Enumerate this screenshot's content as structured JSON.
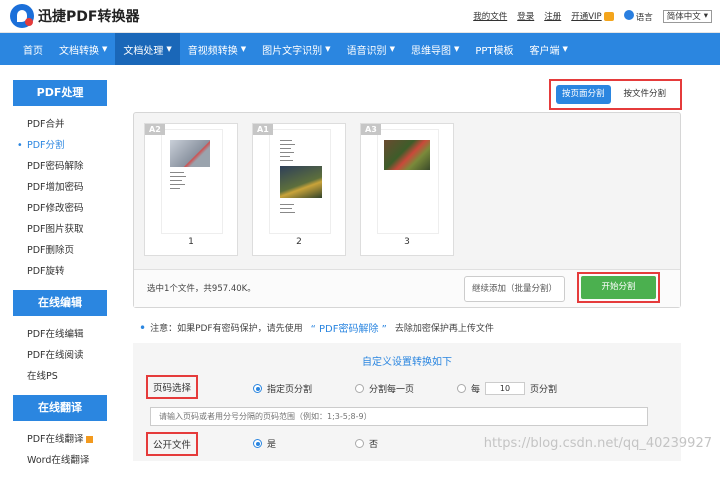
{
  "app": {
    "logo_text": "迅捷PDF转换器"
  },
  "top_links": {
    "my_files": "我的文件",
    "login": "登录",
    "register": "注册",
    "open_vip": "开通VIP",
    "language_label": "语言",
    "language_value": "简体中文"
  },
  "nav": {
    "items": [
      {
        "label": "首页"
      },
      {
        "label": "文档转换"
      },
      {
        "label": "文档处理"
      },
      {
        "label": "音视频转换"
      },
      {
        "label": "图片文字识别"
      },
      {
        "label": "语音识别"
      },
      {
        "label": "思维导图"
      },
      {
        "label": "PPT模板"
      },
      {
        "label": "客户端"
      }
    ]
  },
  "sidebar": {
    "pdf_head": "PDF处理",
    "pdf_items": [
      "PDF合并",
      "PDF分割",
      "PDF密码解除",
      "PDF增加密码",
      "PDF修改密码",
      "PDF图片获取",
      "PDF删除页",
      "PDF旋转"
    ],
    "edit_head": "在线编辑",
    "edit_items": [
      "PDF在线编辑",
      "PDF在线阅读",
      "在线PS"
    ],
    "translate_head": "在线翻译",
    "translate_items": [
      "PDF在线翻译",
      "Word在线翻译"
    ]
  },
  "split_tabs": {
    "by_page": "按页面分割",
    "by_file": "按文件分割"
  },
  "pages": [
    {
      "tag": "A2",
      "num": "1"
    },
    {
      "tag": "A1",
      "num": "2"
    },
    {
      "tag": "A3",
      "num": "3"
    }
  ],
  "preview_footer": {
    "file_info": "选中1个文件，共957.40K。",
    "continue_button": "继续添加（批量分割）",
    "start_button": "开始分割"
  },
  "notice": {
    "prefix": "注意：如果PDF有密码保护，请先使用",
    "link": "“ PDF密码解除 ”",
    "suffix": "去除加密保护再上传文件"
  },
  "settings": {
    "title": "自定义设置转换如下",
    "page_select_label": "页码选择",
    "opt_specified": "指定页分割",
    "opt_each_page": "分割每一页",
    "opt_every": "每",
    "every_value": "10",
    "opt_every_unit": "页分割",
    "range_placeholder": "请输入页码或者用分号分隔的页码范围（例如：1;3-5;8-9）",
    "public_label": "公开文件",
    "public_yes": "是",
    "public_no": "否"
  },
  "watermark": "https://blog.csdn.net/qq_40239927",
  "colors": {
    "brand_blue": "#2b86e0",
    "highlight_red": "#e53b3b",
    "start_green": "#4bb04f"
  }
}
